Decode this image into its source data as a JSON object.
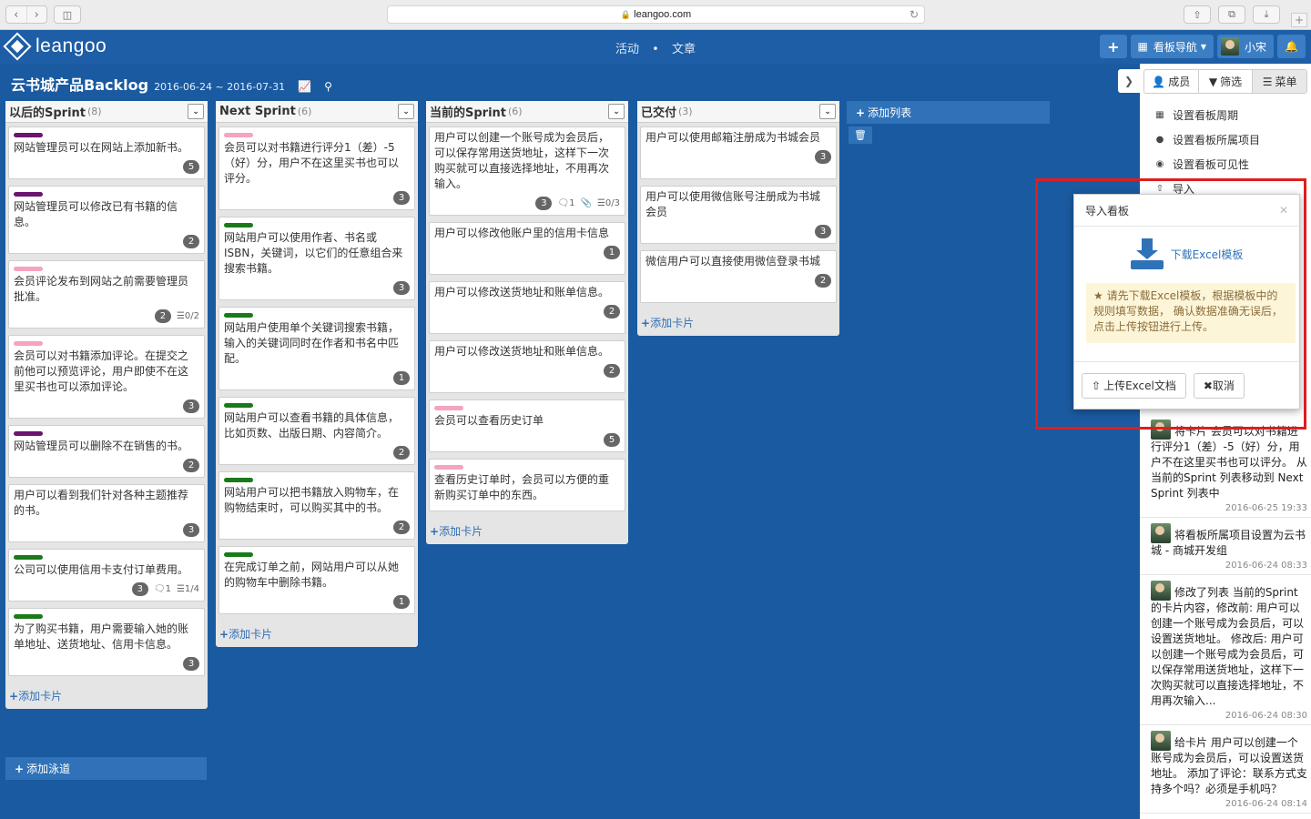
{
  "browser": {
    "url": "leangoo.com"
  },
  "header": {
    "logo": "leangoo",
    "nav": [
      "活动",
      "文章"
    ],
    "plus": "+",
    "board_nav": "看板导航",
    "user": "小宋"
  },
  "board": {
    "title": "云书城产品Backlog",
    "dates": "2016-06-24 ~ 2016-07-31"
  },
  "colors": {
    "purple": "#6b1470",
    "pink": "#f5a3c0",
    "green": "#1a7a1a",
    "brand": "#1d5ea6"
  },
  "columns": [
    {
      "name": "以后的Sprint",
      "count": "(8)",
      "cards": [
        {
          "tag": "purple",
          "text": "网站管理员可以在网站上添加新书。",
          "points": "5"
        },
        {
          "tag": "purple",
          "text": "网站管理员可以修改已有书籍的信息。",
          "points": "2"
        },
        {
          "tag": "pink",
          "text": "会员评论发布到网站之前需要管理员批准。",
          "points": "2",
          "checklist": "0/2"
        },
        {
          "tag": "pink",
          "text": "会员可以对书籍添加评论。在提交之前他可以预览评论，用户即使不在这里买书也可以添加评论。",
          "points": "3"
        },
        {
          "tag": "purple",
          "text": "网站管理员可以删除不在销售的书。",
          "points": "2"
        },
        {
          "tag": "",
          "text": "用户可以看到我们针对各种主题推荐的书。",
          "points": "3"
        },
        {
          "tag": "green",
          "text": "公司可以使用信用卡支付订单费用。",
          "points": "3",
          "comments": "1",
          "checklist": "1/4"
        },
        {
          "tag": "green",
          "text": "为了购买书籍，用户需要输入她的账单地址、送货地址、信用卡信息。",
          "points": "3"
        }
      ]
    },
    {
      "name": "Next Sprint",
      "count": "(6)",
      "cards": [
        {
          "tag": "pink",
          "text": "会员可以对书籍进行评分1（差）-5（好）分，用户不在这里买书也可以评分。",
          "points": "3"
        },
        {
          "tag": "green",
          "text": "网站用户可以使用作者、书名或ISBN，关键词，以它们的任意组合来搜索书籍。",
          "points": "3"
        },
        {
          "tag": "green",
          "text": "网站用户使用单个关键词搜索书籍，输入的关键词同时在作者和书名中匹配。",
          "points": "1"
        },
        {
          "tag": "green",
          "text": "网站用户可以查看书籍的具体信息，比如页数、出版日期、内容简介。",
          "points": "2"
        },
        {
          "tag": "green",
          "text": "网站用户可以把书籍放入购物车，在购物结束时，可以购买其中的书。",
          "points": "2"
        },
        {
          "tag": "green",
          "text": "在完成订单之前，网站用户可以从她的购物车中删除书籍。",
          "points": "1"
        }
      ]
    },
    {
      "name": "当前的Sprint",
      "count": "(6)",
      "cards": [
        {
          "tag": "",
          "text": "用户可以创建一个账号成为会员后，可以保存常用送货地址，这样下一次购买就可以直接选择地址，不用再次输入。",
          "points": "3",
          "comments": "1",
          "attach": true,
          "checklist": "0/3"
        },
        {
          "tag": "",
          "text": "用户可以修改他账户里的信用卡信息",
          "points": "1"
        },
        {
          "tag": "",
          "text": "用户可以修改送货地址和账单信息。",
          "points": "2"
        },
        {
          "tag": "",
          "text": "用户可以修改送货地址和账单信息。",
          "points": "2"
        },
        {
          "tag": "pink",
          "text": "会员可以查看历史订单",
          "points": "5"
        },
        {
          "tag": "pink",
          "text": "查看历史订单时，会员可以方便的重新购买订单中的东西。",
          "points": ""
        }
      ]
    },
    {
      "name": "已交付",
      "count": "(3)",
      "cards": [
        {
          "tag": "",
          "text": "用户可以使用邮箱注册成为书城会员",
          "points": "3"
        },
        {
          "tag": "",
          "text": "用户可以使用微信账号注册成为书城会员",
          "points": "3"
        },
        {
          "tag": "",
          "text": "微信用户可以直接使用微信登录书城",
          "points": "2"
        }
      ]
    }
  ],
  "labels": {
    "add_card": "添加卡片",
    "add_column": "添加列表",
    "add_lane": "添加泳道"
  },
  "right_panel": {
    "tabs": [
      "成员",
      "筛选",
      "菜单"
    ],
    "menu": [
      "设置看板周期",
      "设置看板所属项目",
      "设置看板可见性",
      "导入"
    ],
    "activities": [
      {
        "text": "将卡片 会员可以对书籍进行评分1（差）-5（好）分，用户不在这里买书也可以评分。 从 当前的Sprint 列表移动到 Next Sprint 列表中",
        "time": "2016-06-25 19:33"
      },
      {
        "text": "将看板所属项目设置为云书城 - 商城开发组",
        "time": "2016-06-24 08:33"
      },
      {
        "text": "修改了列表 当前的Sprint 的卡片内容，修改前: 用户可以创建一个账号成为会员后，可以设置送货地址。 修改后: 用户可以创建一个账号成为会员后，可以保存常用送货地址，这样下一次购买就可以直接选择地址，不用再次输入...",
        "time": "2016-06-24 08:30"
      },
      {
        "text": "给卡片 用户可以创建一个账号成为会员后，可以设置送货地址。 添加了评论：联系方式支持多个吗？必须是手机吗？",
        "time": "2016-06-24 08:14"
      }
    ]
  },
  "modal": {
    "title": "导入看板",
    "download": "下载Excel模板",
    "notice": "请先下载Excel模板，根据模板中的规则填写数据， 确认数据准确无误后，点击上传按钮进行上传。",
    "upload": "上传Excel文档",
    "cancel": "取消"
  }
}
